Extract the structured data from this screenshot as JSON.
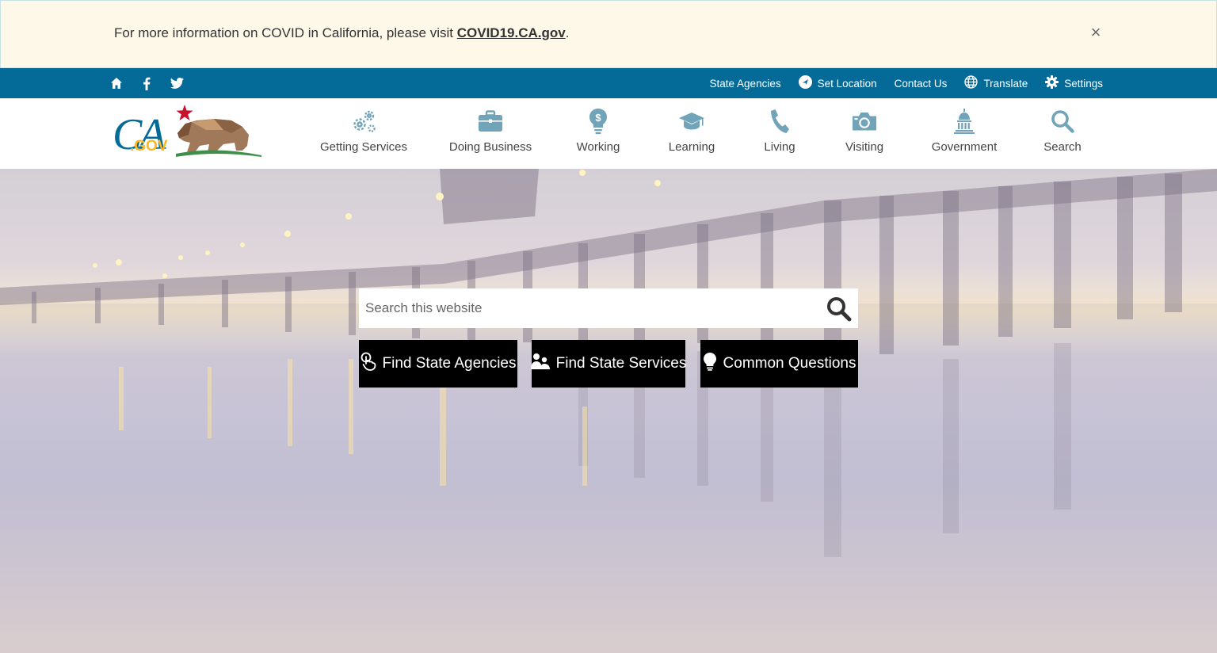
{
  "alert": {
    "message": "For more information on COVID in California, please visit ",
    "link_text": "COVID19.CA.gov",
    "suffix": ".",
    "close_symbol": "×"
  },
  "utility": {
    "left_icons": [
      "home-icon",
      "facebook-icon",
      "twitter-icon"
    ],
    "state_agencies": "State Agencies",
    "set_location": "Set Location",
    "contact_us": "Contact Us",
    "translate": "Translate",
    "settings": "Settings"
  },
  "logo": {
    "text": "CA",
    "suffix": ".GOV"
  },
  "nav": [
    {
      "label": "Getting Services",
      "icon": "gears-icon"
    },
    {
      "label": "Doing Business",
      "icon": "briefcase-icon"
    },
    {
      "label": "Working",
      "icon": "money-bulb-icon"
    },
    {
      "label": "Learning",
      "icon": "graduation-cap-icon"
    },
    {
      "label": "Living",
      "icon": "phone-icon"
    },
    {
      "label": "Visiting",
      "icon": "camera-icon"
    },
    {
      "label": "Government",
      "icon": "capitol-icon"
    },
    {
      "label": "Search",
      "icon": "search-icon"
    }
  ],
  "hero": {
    "search_placeholder": "Search this website",
    "buttons": [
      {
        "label": "Find State Agencies",
        "icon": "touch-icon"
      },
      {
        "label": "Find State Services",
        "icon": "people-icon"
      },
      {
        "label": "Common Questions",
        "icon": "lightbulb-icon"
      }
    ]
  },
  "colors": {
    "utility_bar": "#046b99",
    "nav_icon": "#71a4b9",
    "alert_bg": "#fef8e9",
    "button_bg": "#000000"
  }
}
